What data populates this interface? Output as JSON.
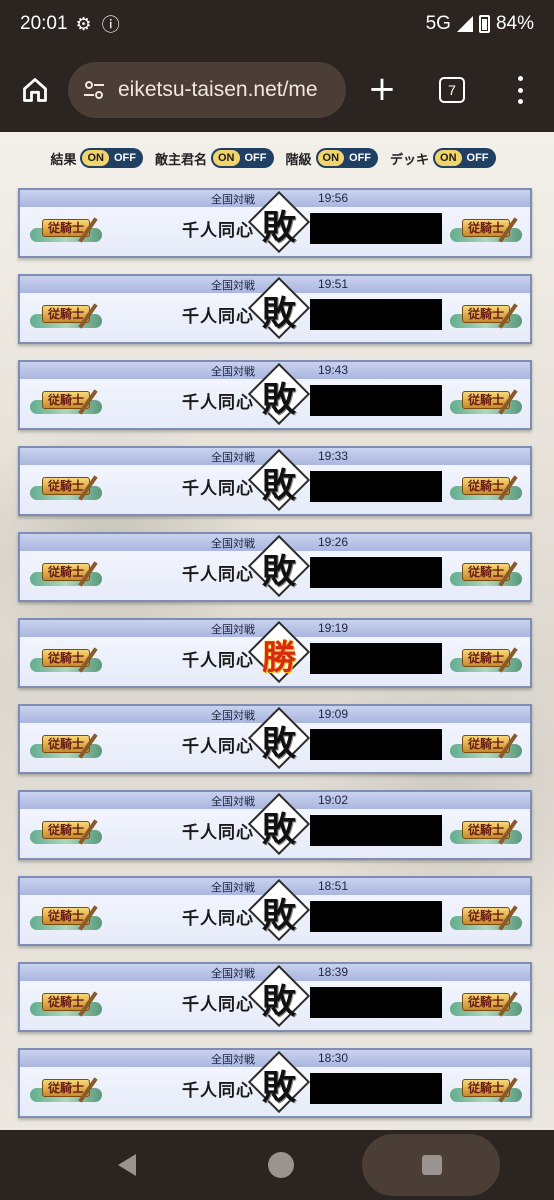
{
  "status": {
    "time": "20:01",
    "network": "5G",
    "battery": "84%"
  },
  "browser": {
    "url": "eiketsu-taisen.net/me",
    "tab_count": "7"
  },
  "filters": [
    {
      "label": "結果",
      "on": "ON",
      "off": "OFF",
      "active": "on"
    },
    {
      "label": "敵主君名",
      "on": "ON",
      "off": "OFF",
      "active": "on"
    },
    {
      "label": "階級",
      "on": "ON",
      "off": "OFF",
      "active": "on"
    },
    {
      "label": "デッキ",
      "on": "ON",
      "off": "OFF",
      "active": "on"
    }
  ],
  "records": [
    {
      "mode": "全国対戦",
      "time": "19:56",
      "deck": "千人同心",
      "result": "敗",
      "rank": "従騎士"
    },
    {
      "mode": "全国対戦",
      "time": "19:51",
      "deck": "千人同心",
      "result": "敗",
      "rank": "従騎士"
    },
    {
      "mode": "全国対戦",
      "time": "19:43",
      "deck": "千人同心",
      "result": "敗",
      "rank": "従騎士"
    },
    {
      "mode": "全国対戦",
      "time": "19:33",
      "deck": "千人同心",
      "result": "敗",
      "rank": "従騎士"
    },
    {
      "mode": "全国対戦",
      "time": "19:26",
      "deck": "千人同心",
      "result": "敗",
      "rank": "従騎士"
    },
    {
      "mode": "全国対戦",
      "time": "19:19",
      "deck": "千人同心",
      "result": "勝",
      "rank": "従騎士"
    },
    {
      "mode": "全国対戦",
      "time": "19:09",
      "deck": "千人同心",
      "result": "敗",
      "rank": "従騎士"
    },
    {
      "mode": "全国対戦",
      "time": "19:02",
      "deck": "千人同心",
      "result": "敗",
      "rank": "従騎士"
    },
    {
      "mode": "全国対戦",
      "time": "18:51",
      "deck": "千人同心",
      "result": "敗",
      "rank": "従騎士"
    },
    {
      "mode": "全国対戦",
      "time": "18:39",
      "deck": "千人同心",
      "result": "敗",
      "rank": "従騎士"
    },
    {
      "mode": "全国対戦",
      "time": "18:30",
      "deck": "千人同心",
      "result": "敗",
      "rank": "従騎士"
    }
  ],
  "icons": {
    "home": "home-icon",
    "tune": "site-settings-icon",
    "new_tab": "plus-icon",
    "menu": "more-vert-icon",
    "back": "back-icon",
    "nav_home": "home-circle-icon",
    "recents": "recents-icon"
  },
  "colors": {
    "toggle_active": "#f1d46b",
    "toggle_bg": "#1f3f63",
    "win": "#d82a10",
    "chrome": "#2b2420"
  }
}
